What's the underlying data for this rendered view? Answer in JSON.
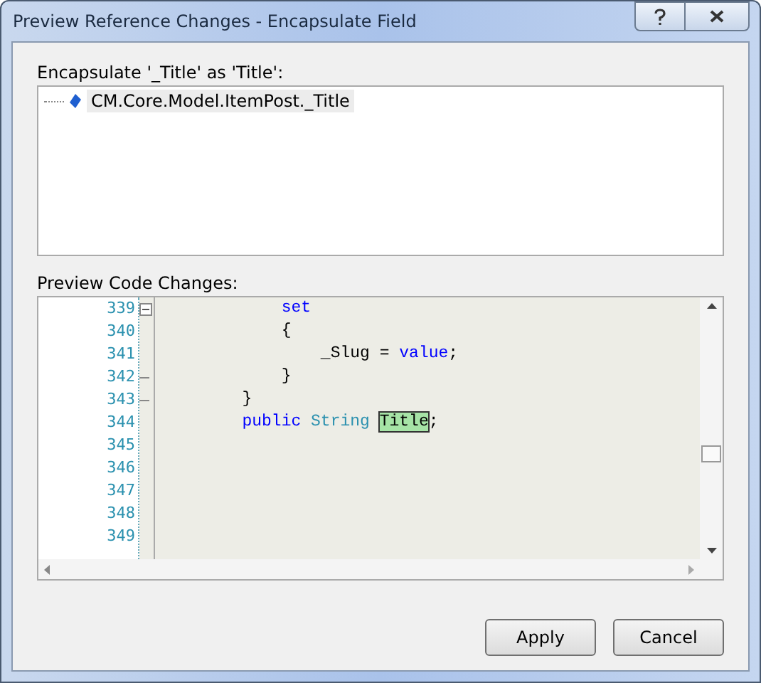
{
  "window": {
    "title": "Preview Reference Changes - Encapsulate Field"
  },
  "tree": {
    "label": "Encapsulate '_Title' as 'Title':",
    "items": [
      {
        "text": "CM.Core.Model.ItemPost._Title",
        "selected": true
      }
    ]
  },
  "code": {
    "label": "Preview Code Changes:",
    "lines": [
      {
        "number": "339",
        "kind": "fold_start",
        "tokens": [
          {
            "kind": "keyword",
            "text": "            set"
          }
        ]
      },
      {
        "number": "340",
        "kind": "plain",
        "tokens": [
          {
            "kind": "plain",
            "text": "            {"
          }
        ]
      },
      {
        "number": "341",
        "kind": "plain",
        "tokens": [
          {
            "kind": "plain",
            "text": "                _Slug = "
          },
          {
            "kind": "keyword",
            "text": "value"
          },
          {
            "kind": "plain",
            "text": ";"
          }
        ]
      },
      {
        "number": "342",
        "kind": "fold_end",
        "tokens": [
          {
            "kind": "plain",
            "text": "            }"
          }
        ]
      },
      {
        "number": "343",
        "kind": "fold_end",
        "tokens": [
          {
            "kind": "plain",
            "text": "        }"
          }
        ]
      },
      {
        "number": "344",
        "kind": "plain",
        "tokens": [
          {
            "kind": "keyword",
            "text": "        public "
          },
          {
            "kind": "type",
            "text": "String "
          },
          {
            "kind": "highlight",
            "text": "Title"
          },
          {
            "kind": "plain",
            "text": ";"
          }
        ]
      },
      {
        "number": "345",
        "kind": "plain"
      },
      {
        "number": "346",
        "kind": "plain"
      },
      {
        "number": "347",
        "kind": "plain"
      },
      {
        "number": "348",
        "kind": "plain"
      },
      {
        "number": "349",
        "kind": "plain"
      }
    ]
  },
  "buttons": [
    "Apply",
    "Cancel"
  ]
}
